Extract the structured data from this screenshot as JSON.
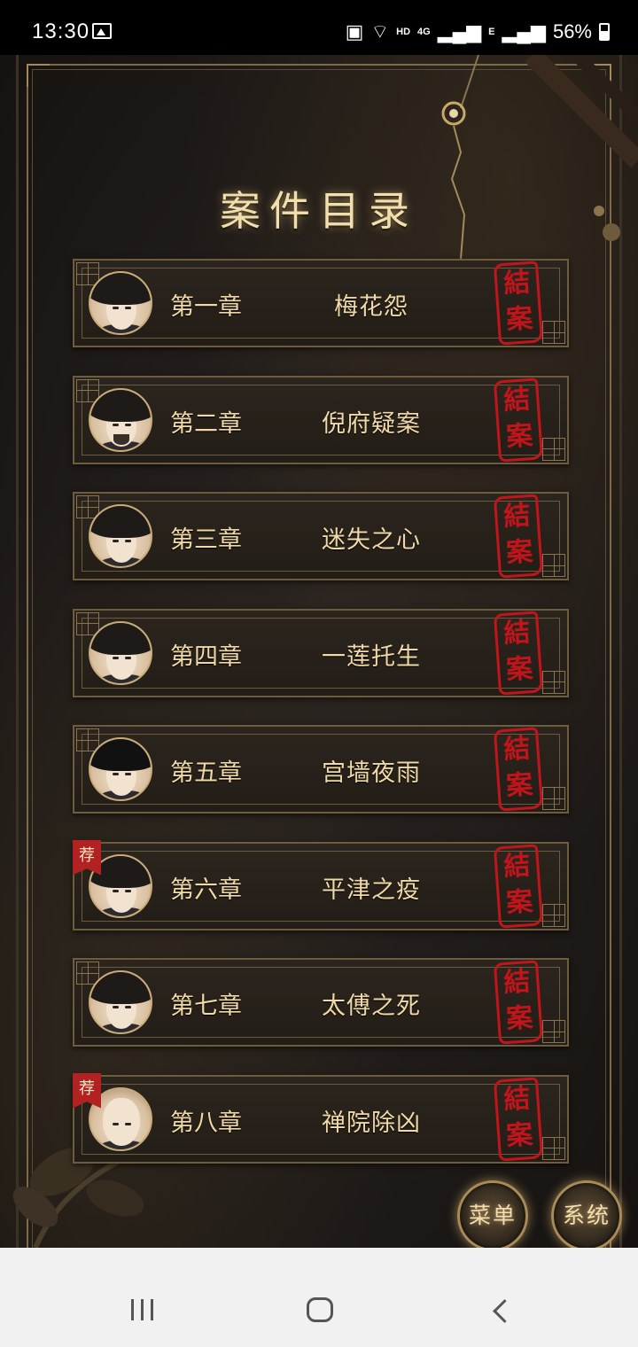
{
  "status_bar": {
    "time": "13:30",
    "network_label": "HD",
    "signal1": "4G",
    "signal2": "E",
    "battery": "56%"
  },
  "game": {
    "title": "案件目录",
    "cases": [
      {
        "chapter": "第一章",
        "name": "梅花怨",
        "stamp": [
          "結",
          "案"
        ],
        "recommended": false
      },
      {
        "chapter": "第二章",
        "name": "倪府疑案",
        "stamp": [
          "結",
          "案"
        ],
        "recommended": false
      },
      {
        "chapter": "第三章",
        "name": "迷失之心",
        "stamp": [
          "結",
          "案"
        ],
        "recommended": false
      },
      {
        "chapter": "第四章",
        "name": "一莲托生",
        "stamp": [
          "結",
          "案"
        ],
        "recommended": false
      },
      {
        "chapter": "第五章",
        "name": "宫墙夜雨",
        "stamp": [
          "結",
          "案"
        ],
        "recommended": false
      },
      {
        "chapter": "第六章",
        "name": "平津之疫",
        "stamp": [
          "結",
          "案"
        ],
        "recommended": true,
        "badge": "荐"
      },
      {
        "chapter": "第七章",
        "name": "太傅之死",
        "stamp": [
          "結",
          "案"
        ],
        "recommended": false
      },
      {
        "chapter": "第八章",
        "name": "禅院除凶",
        "stamp": [
          "結",
          "案"
        ],
        "recommended": true,
        "badge": "荐"
      }
    ],
    "menu_button": "菜单",
    "system_button": "系统"
  },
  "colors": {
    "gold_text": "#f0d9a6",
    "seal_red": "#c2141b",
    "frame": "#6e5c3e"
  },
  "icons": {
    "nav_recent": "recent-apps-icon",
    "nav_home": "home-icon",
    "nav_back": "back-icon"
  }
}
